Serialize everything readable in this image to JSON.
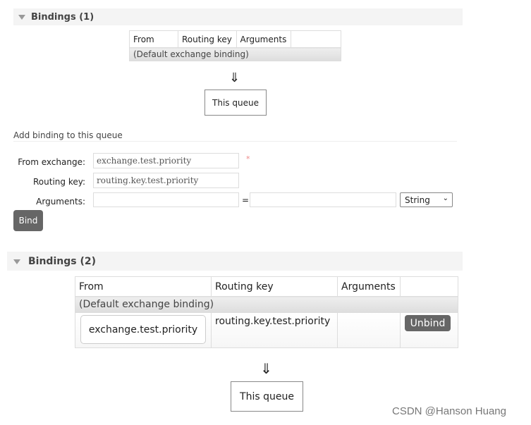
{
  "section1": {
    "title": "Bindings (1)",
    "columns": [
      "From",
      "Routing key",
      "Arguments",
      ""
    ],
    "default_row": "(Default exchange binding)",
    "arrow": "⇓",
    "queue_label": "This queue"
  },
  "add_binding": {
    "title": "Add binding to this queue",
    "from_label": "From exchange:",
    "from_value": "exchange.test.priority",
    "required_mark": "*",
    "routing_label": "Routing key:",
    "routing_value": "routing.key.test.priority",
    "arguments_label": "Arguments:",
    "arg_key": "",
    "equals": "=",
    "arg_value": "",
    "type_select": "String",
    "bind_button": "Bind"
  },
  "section2": {
    "title": "Bindings (2)",
    "columns": [
      "From",
      "Routing key",
      "Arguments",
      ""
    ],
    "default_row": "(Default exchange binding)",
    "rows": [
      {
        "from": "exchange.test.priority",
        "routing_key": "routing.key.test.priority",
        "arguments": "",
        "action": "Unbind"
      }
    ],
    "arrow": "⇓",
    "queue_label": "This queue"
  },
  "watermark": "CSDN @Hanson Huang"
}
